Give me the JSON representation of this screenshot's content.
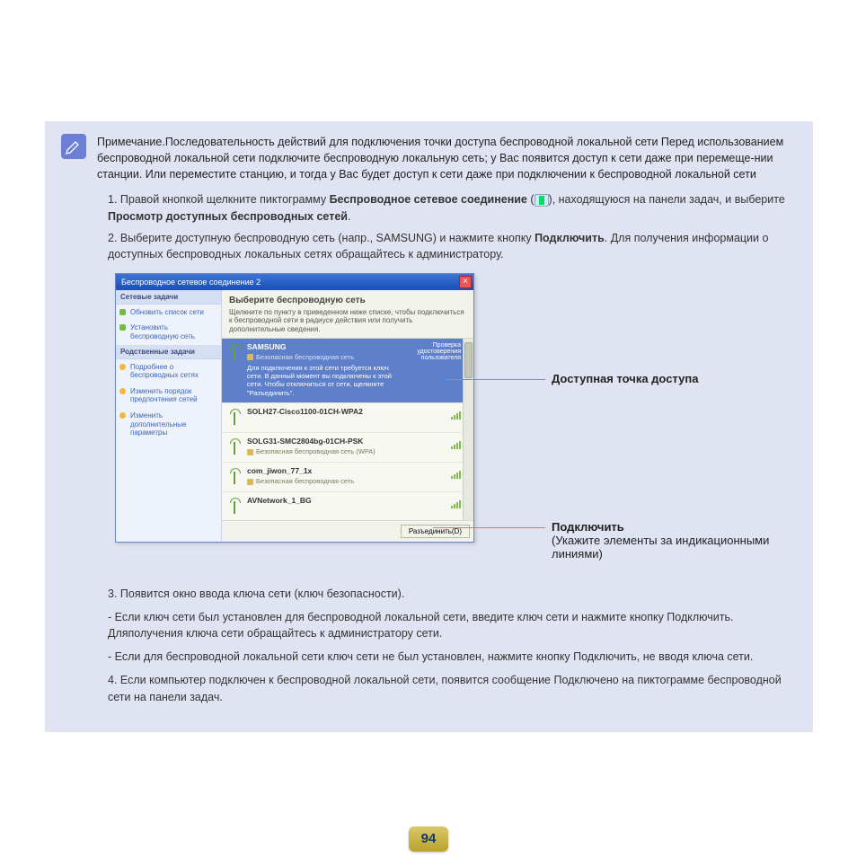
{
  "note": {
    "text": "Примечание.Последовательность действий для подключения точки доступа беспроводной локальной сети Перед использованием беспроводной локальной сети подключите беспроводную локальную сеть; у Вас появится доступ к сети даже при перемеще-нии станции. Или переместите станцию, и тогда у Вас будет доступ к сети даже при подключении к беспроводной локальной сети"
  },
  "steps": {
    "s1_a": "1. Правой кнопкой щелкните пиктограмму ",
    "s1_bold": "Беспроводное сетевое соединение",
    "s1_b": " (",
    "s1_c": "), находящуюся на панели задач, и выберите ",
    "s1_bold2": "Просмотр доступных беспроводных сетей",
    "s1_d": ".",
    "s2_a": "2. Выберите доступную беспроводную сеть (напр., SAMSUNG) и нажмите кнопку ",
    "s2_bold": "Подключить",
    "s2_b": ". Для получения информации о доступных беспроводных локальных сетях обращайтесь к администратору."
  },
  "win": {
    "title": "Беспроводное сетевое соединение 2",
    "sidebar": {
      "head1": "Сетевые задачи",
      "items1": [
        "Обновить список сети",
        "Установить беспроводную сеть"
      ],
      "head2": "Родственные задачи",
      "items2": [
        "Подробнее о беспроводных сетях",
        "Изменить порядок предпочтения сетей",
        "Изменить дополнительные параметры"
      ]
    },
    "main": {
      "title": "Выберите беспроводную сеть",
      "sub": "Щелкните по пункту в приведенном ниже списке, чтобы подключиться к беспроводной сети в радиусе действия или получить дополнительные сведения."
    },
    "networks": [
      {
        "name": "SAMSUNG",
        "right": "Проверка удостоверения пользователя",
        "sec": "Безопасная беспроводная сеть",
        "desc": "Для подключения к этой сети требуется ключ сети. В данный момент вы подключены к этой сети. Чтобы отключиться от сети, щелкните \"Разъединить\".",
        "selected": true
      },
      {
        "name": "SOLH27-Cisco1100-01CH-WPA2",
        "sec": "",
        "desc": ""
      },
      {
        "name": "SOLG31-SMC2804bg-01CH-PSK",
        "sec": "Безопасная беспроводная сеть (WPA)",
        "desc": ""
      },
      {
        "name": "com_jiwon_77_1x",
        "sec": "Безопасная беспроводная сеть",
        "desc": ""
      },
      {
        "name": "AVNetwork_1_BG",
        "sec": "",
        "desc": ""
      }
    ],
    "connect_btn": "Разъединить(D)"
  },
  "callouts": {
    "c1": "Доступная точка доступа",
    "c2_title": "Подключить",
    "c2_sub": "(Укажите элементы за индикационными линиями)"
  },
  "after": {
    "p3": "3. Появится окно ввода ключа сети (ключ безопасности).",
    "d1": "- Если ключ сети был установлен для беспроводной локальной сети, введите ключ сети и нажмите кнопку Подключить. Дляполучения ключа сети обращайтесь к администратору сети.",
    "d2": "- Если для беспроводной локальной сети ключ сети не был установлен, нажмите кнопку Подключить, не вводя ключа сети.",
    "p4": "4. Если компьютер подключен к беспроводной локальной сети, появится сообщение Подключено на пиктограмме беспроводной сети на панели задач."
  },
  "page_number": "94"
}
